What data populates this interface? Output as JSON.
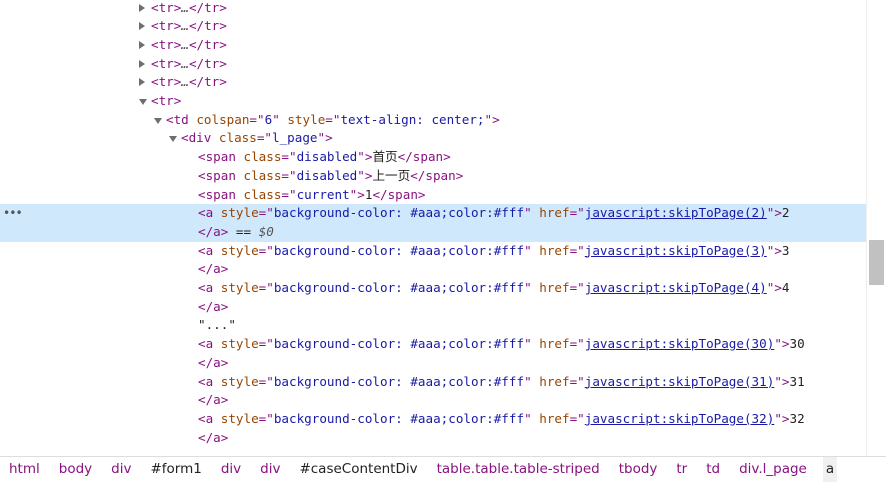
{
  "elements": {
    "rows": [
      {
        "indent": 140,
        "tri": "right",
        "html": [
          [
            "tag",
            "<tr>"
          ],
          [
            "dim",
            "…"
          ],
          [
            "tag",
            "</tr>"
          ]
        ],
        "name": "node-tr-collapsed"
      },
      {
        "indent": 140,
        "tri": "right",
        "html": [
          [
            "tag",
            "<tr>"
          ],
          [
            "dim",
            "…"
          ],
          [
            "tag",
            "</tr>"
          ]
        ],
        "name": "node-tr-collapsed"
      },
      {
        "indent": 140,
        "tri": "right",
        "html": [
          [
            "tag",
            "<tr>"
          ],
          [
            "dim",
            "…"
          ],
          [
            "tag",
            "</tr>"
          ]
        ],
        "name": "node-tr-collapsed"
      },
      {
        "indent": 140,
        "tri": "right",
        "html": [
          [
            "tag",
            "<tr>"
          ],
          [
            "dim",
            "…"
          ],
          [
            "tag",
            "</tr>"
          ]
        ],
        "name": "node-tr-collapsed"
      },
      {
        "indent": 140,
        "tri": "right",
        "html": [
          [
            "tag",
            "<tr>"
          ],
          [
            "dim",
            "…"
          ],
          [
            "tag",
            "</tr>"
          ]
        ],
        "name": "node-tr-collapsed"
      },
      {
        "indent": 140,
        "tri": "down",
        "html": [
          [
            "tag",
            "<tr>"
          ]
        ],
        "name": "node-tr-expanded"
      },
      {
        "indent": 155,
        "tri": "down",
        "html": [
          [
            "tag",
            "<td "
          ],
          [
            "an",
            "colspan"
          ],
          [
            "tag",
            "=\""
          ],
          [
            "av",
            "6"
          ],
          [
            "tag",
            "\" "
          ],
          [
            "an",
            "style"
          ],
          [
            "tag",
            "=\""
          ],
          [
            "av",
            "text-align: center;"
          ],
          [
            "tag",
            "\">"
          ]
        ],
        "name": "node-td"
      },
      {
        "indent": 170,
        "tri": "down",
        "html": [
          [
            "tag",
            "<div "
          ],
          [
            "an",
            "class"
          ],
          [
            "tag",
            "=\""
          ],
          [
            "av",
            "l_page"
          ],
          [
            "tag",
            "\">"
          ]
        ],
        "name": "node-div-l-page"
      },
      {
        "indent": 185,
        "tri": "",
        "html": [
          [
            "tag",
            "<span "
          ],
          [
            "an",
            "class"
          ],
          [
            "tag",
            "=\""
          ],
          [
            "av",
            "disabled"
          ],
          [
            "tag",
            "\">"
          ],
          [
            "cjk",
            "首页"
          ],
          [
            "tag",
            "</span>"
          ]
        ],
        "name": "node-span-first"
      },
      {
        "indent": 185,
        "tri": "",
        "html": [
          [
            "tag",
            "<span "
          ],
          [
            "an",
            "class"
          ],
          [
            "tag",
            "=\""
          ],
          [
            "av",
            "disabled"
          ],
          [
            "tag",
            "\">"
          ],
          [
            "cjk",
            "上一页"
          ],
          [
            "tag",
            "</span>"
          ]
        ],
        "name": "node-span-prev"
      },
      {
        "indent": 185,
        "tri": "",
        "html": [
          [
            "tag",
            "<span "
          ],
          [
            "an",
            "class"
          ],
          [
            "tag",
            "=\""
          ],
          [
            "av",
            "current"
          ],
          [
            "tag",
            "\">"
          ],
          [
            "txt",
            "1"
          ],
          [
            "tag",
            "</span>"
          ]
        ],
        "name": "node-span-current"
      },
      {
        "indent": 185,
        "tri": "",
        "sel": true,
        "html": [
          [
            "tag",
            "<a "
          ],
          [
            "an",
            "style"
          ],
          [
            "tag",
            "=\""
          ],
          [
            "av",
            "background-color: #aaa;color:#fff"
          ],
          [
            "tag",
            "\" "
          ],
          [
            "an",
            "href"
          ],
          [
            "tag",
            "=\""
          ],
          [
            "lnk",
            "javascript:skipToPage(2)"
          ],
          [
            "tag",
            "\">"
          ],
          [
            "txt",
            "2"
          ]
        ],
        "name": "node-a-page-2"
      },
      {
        "indent": 185,
        "tri": "",
        "sel": true,
        "html": [
          [
            "tag",
            "</a>"
          ],
          [
            "txt",
            " == "
          ],
          [
            "dim",
            "$0"
          ]
        ],
        "name": "node-a-close"
      },
      {
        "indent": 185,
        "tri": "",
        "html": [
          [
            "tag",
            "<a "
          ],
          [
            "an",
            "style"
          ],
          [
            "tag",
            "=\""
          ],
          [
            "av",
            "background-color: #aaa;color:#fff"
          ],
          [
            "tag",
            "\" "
          ],
          [
            "an",
            "href"
          ],
          [
            "tag",
            "=\""
          ],
          [
            "lnk",
            "javascript:skipToPage(3)"
          ],
          [
            "tag",
            "\">"
          ],
          [
            "txt",
            "3"
          ]
        ],
        "name": "node-a-page-3"
      },
      {
        "indent": 185,
        "tri": "",
        "html": [
          [
            "tag",
            "</a>"
          ]
        ],
        "name": "node-a-close"
      },
      {
        "indent": 185,
        "tri": "",
        "html": [
          [
            "tag",
            "<a "
          ],
          [
            "an",
            "style"
          ],
          [
            "tag",
            "=\""
          ],
          [
            "av",
            "background-color: #aaa;color:#fff"
          ],
          [
            "tag",
            "\" "
          ],
          [
            "an",
            "href"
          ],
          [
            "tag",
            "=\""
          ],
          [
            "lnk",
            "javascript:skipToPage(4)"
          ],
          [
            "tag",
            "\">"
          ],
          [
            "txt",
            "4"
          ]
        ],
        "name": "node-a-page-4"
      },
      {
        "indent": 185,
        "tri": "",
        "html": [
          [
            "tag",
            "</a>"
          ]
        ],
        "name": "node-a-close"
      },
      {
        "indent": 185,
        "tri": "",
        "html": [
          [
            "txt",
            "\"...\""
          ]
        ],
        "name": "node-text-ellipsis"
      },
      {
        "indent": 185,
        "tri": "",
        "html": [
          [
            "tag",
            "<a "
          ],
          [
            "an",
            "style"
          ],
          [
            "tag",
            "=\""
          ],
          [
            "av",
            "background-color: #aaa;color:#fff"
          ],
          [
            "tag",
            "\" "
          ],
          [
            "an",
            "href"
          ],
          [
            "tag",
            "=\""
          ],
          [
            "lnk",
            "javascript:skipToPage(30)"
          ],
          [
            "tag",
            "\">"
          ],
          [
            "txt",
            "30"
          ]
        ],
        "name": "node-a-page-30"
      },
      {
        "indent": 185,
        "tri": "",
        "html": [
          [
            "tag",
            "</a>"
          ]
        ],
        "name": "node-a-close"
      },
      {
        "indent": 185,
        "tri": "",
        "html": [
          [
            "tag",
            "<a "
          ],
          [
            "an",
            "style"
          ],
          [
            "tag",
            "=\""
          ],
          [
            "av",
            "background-color: #aaa;color:#fff"
          ],
          [
            "tag",
            "\" "
          ],
          [
            "an",
            "href"
          ],
          [
            "tag",
            "=\""
          ],
          [
            "lnk",
            "javascript:skipToPage(31)"
          ],
          [
            "tag",
            "\">"
          ],
          [
            "txt",
            "31"
          ]
        ],
        "name": "node-a-page-31"
      },
      {
        "indent": 185,
        "tri": "",
        "html": [
          [
            "tag",
            "</a>"
          ]
        ],
        "name": "node-a-close"
      },
      {
        "indent": 185,
        "tri": "",
        "html": [
          [
            "tag",
            "<a "
          ],
          [
            "an",
            "style"
          ],
          [
            "tag",
            "=\""
          ],
          [
            "av",
            "background-color: #aaa;color:#fff"
          ],
          [
            "tag",
            "\" "
          ],
          [
            "an",
            "href"
          ],
          [
            "tag",
            "=\""
          ],
          [
            "lnk",
            "javascript:skipToPage(32)"
          ],
          [
            "tag",
            "\">"
          ],
          [
            "txt",
            "32"
          ]
        ],
        "name": "node-a-page-32"
      },
      {
        "indent": 185,
        "tri": "",
        "html": [
          [
            "tag",
            "</a>"
          ]
        ],
        "name": "node-a-close"
      }
    ],
    "selected_marker": "•••",
    "breadcrumb": [
      {
        "label": "html",
        "style": "tag"
      },
      {
        "label": "body",
        "style": "tag"
      },
      {
        "label": "div",
        "style": "tag"
      },
      {
        "label": "#form1",
        "style": "plain"
      },
      {
        "label": "div",
        "style": "tag"
      },
      {
        "label": "div",
        "style": "tag"
      },
      {
        "label": "#caseContentDiv",
        "style": "plain"
      },
      {
        "label": "table.table.table-striped",
        "style": "tag"
      },
      {
        "label": "tbody",
        "style": "tag"
      },
      {
        "label": "tr",
        "style": "tag"
      },
      {
        "label": "td",
        "style": "tag"
      },
      {
        "label": "div.l_page",
        "style": "tag"
      },
      {
        "label": "a",
        "style": "last"
      }
    ]
  },
  "colors": {
    "tag": "#881280",
    "attr_name": "#994500",
    "attr_value": "#1a1aa6",
    "selected_row": "#cfe8fc"
  }
}
